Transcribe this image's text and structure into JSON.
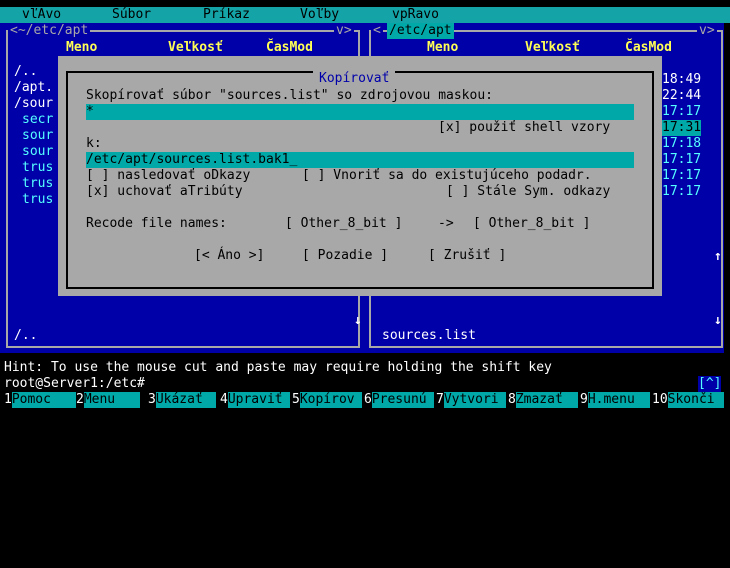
{
  "menu": [
    "vľAvo",
    "Súbor",
    "Príkaz",
    "Voľby",
    "vpRavo"
  ],
  "left_panel": {
    "path": "<~/etc/apt",
    "path_suffix": "v>",
    "headers": [
      "Meno",
      "Veľkosť",
      "ČasMod"
    ],
    "files": [
      "/..",
      "/apt.",
      "/sour",
      "secr",
      "sour",
      "sour",
      "trus",
      "trus",
      "trus"
    ],
    "footer": "/.."
  },
  "right_panel": {
    "path": "<",
    "path_name": "/etc/apt",
    "path_suffix": "v>",
    "headers": [
      "Meno",
      "Veľkosť",
      "ČasMod"
    ],
    "times": [
      "18:49",
      "22:44",
      "17:17",
      "17:31",
      "17:18",
      "17:17",
      "17:17",
      "17:17"
    ],
    "footer": "sources.list"
  },
  "dialog": {
    "title": "Kopírovať",
    "line1": "Skopírovať súbor \"sources.list\" so zdrojovou maskou:",
    "mask_value": "*",
    "shell_patterns": "[x] použiť shell vzory",
    "to_label": "k:",
    "dest_value": "/etc/apt/sources.list.bak1_",
    "follow_links": "[ ] nasledovať oDkazy",
    "dive_subdir": "[ ] Vnoriť sa do existujúceho podadr.",
    "preserve_attrs": "[x] uchovať aTribúty",
    "stable_symlinks": "[ ] Stále Sym. odkazy",
    "recode_label": "Recode file names:",
    "recode_from": "[ Other_8_bit ]",
    "recode_arrow": "->",
    "recode_to": "[ Other_8_bit ]",
    "btn_ok": "[< Áno >]",
    "btn_background": "[ Pozadie ]",
    "btn_cancel": "[ Zrušiť ]"
  },
  "hint": "Hint: To use the mouse cut and paste may require holding the shift key",
  "prompt": "root@Server1:/etc#",
  "prompt_right": "[^]",
  "fkeys": [
    {
      "num": "1",
      "label": "Pomoc "
    },
    {
      "num": "2",
      "label": "Menu  "
    },
    {
      "num": "3",
      "label": "Ukázať"
    },
    {
      "num": "4",
      "label": "Upraviť"
    },
    {
      "num": "5",
      "label": "Kopírov"
    },
    {
      "num": "6",
      "label": "Presunú"
    },
    {
      "num": "7",
      "label": "Vytvori"
    },
    {
      "num": "8",
      "label": "Zmazať"
    },
    {
      "num": "9",
      "label": "H.menu"
    },
    {
      "num": "10",
      "label": "Skonči"
    }
  ]
}
